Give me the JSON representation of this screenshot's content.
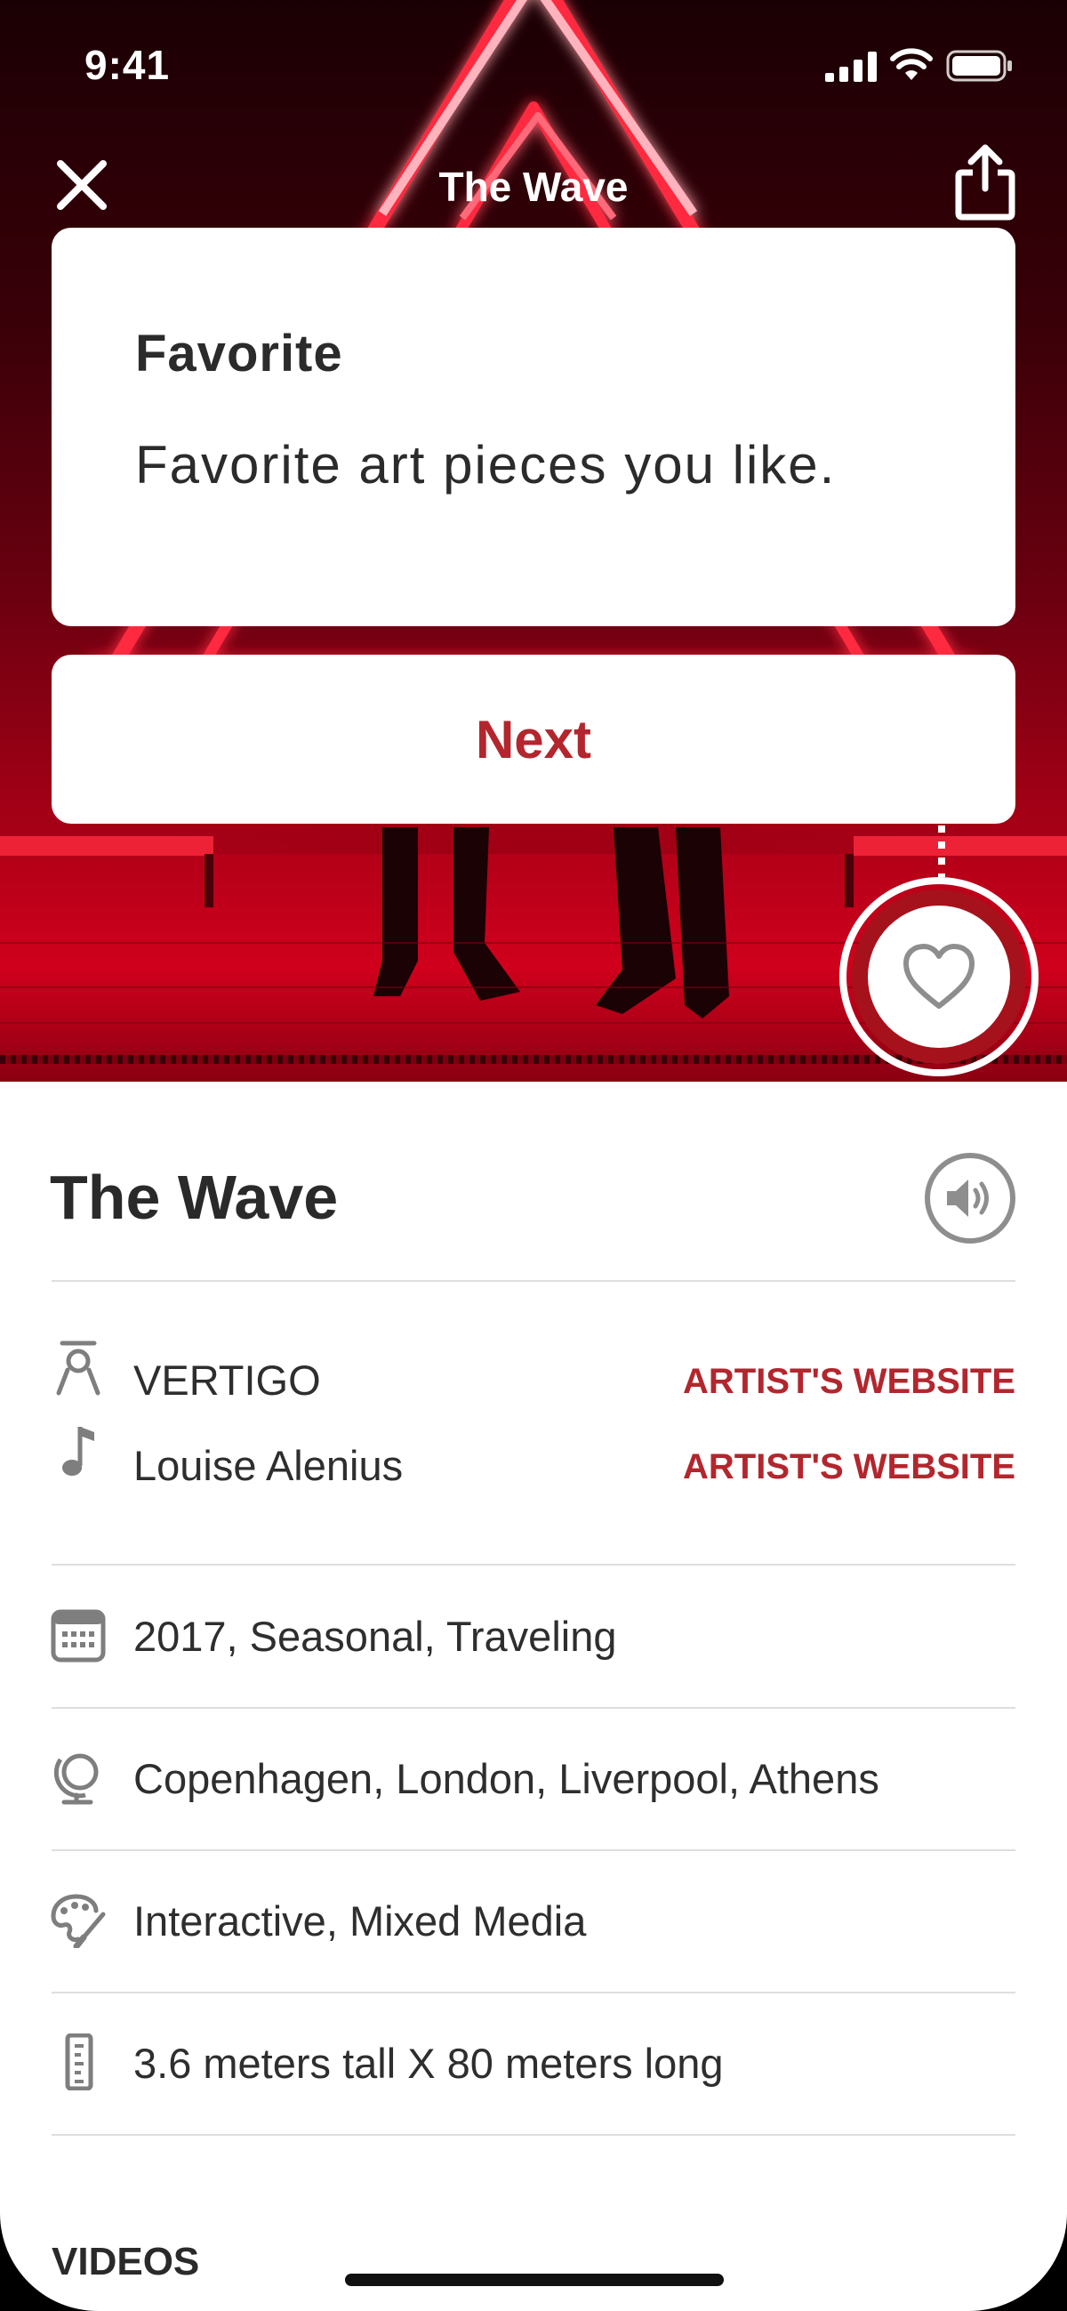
{
  "status_bar": {
    "time": "9:41"
  },
  "nav": {
    "title": "The Wave"
  },
  "tooltip": {
    "title": "Favorite",
    "body": "Favorite art pieces you like.",
    "next_label": "Next"
  },
  "artwork": {
    "title": "The Wave",
    "credits": [
      {
        "icon": "artist-icon",
        "name": "VERTIGO",
        "link": "ARTIST'S WEBSITE"
      },
      {
        "icon": "music-note-icon",
        "name": "Louise Alenius",
        "link": "ARTIST'S WEBSITE"
      }
    ],
    "details": [
      {
        "icon": "calendar-icon",
        "text": "2017, Seasonal, Traveling"
      },
      {
        "icon": "globe-icon",
        "text": "Copenhagen, London, Liverpool, Athens"
      },
      {
        "icon": "palette-icon",
        "text": "Interactive, Mixed Media"
      },
      {
        "icon": "ruler-icon",
        "text": "3.6 meters tall X 80 meters long"
      }
    ],
    "section_videos": "VIDEOS"
  },
  "colors": {
    "accent": "#b3262d",
    "text": "#2a2a2a",
    "divider": "#dedede"
  }
}
